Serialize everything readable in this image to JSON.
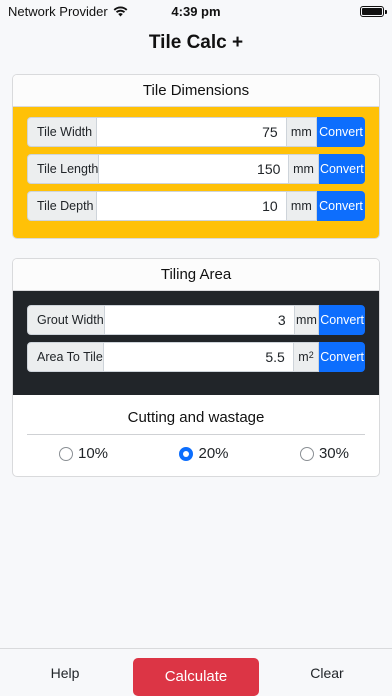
{
  "status_bar": {
    "carrier": "Network Provider",
    "time": "4:39 pm",
    "wifi_icon": "wifi-icon",
    "battery_icon": "battery-icon"
  },
  "app": {
    "title": "Tile Calc +"
  },
  "tile_dimensions": {
    "header": "Tile Dimensions",
    "accent_color": "#ffc107",
    "rows": [
      {
        "label": "Tile Width",
        "value": "75",
        "unit": "mm",
        "button": "Convert"
      },
      {
        "label": "Tile Length",
        "value": "150",
        "unit": "mm",
        "button": "Convert"
      },
      {
        "label": "Tile Depth",
        "value": "10",
        "unit": "mm",
        "button": "Convert"
      }
    ]
  },
  "tiling_area": {
    "header": "Tiling Area",
    "accent_color": "#212529",
    "rows": [
      {
        "label": "Grout Width",
        "value": "3",
        "unit": "mm",
        "button": "Convert"
      },
      {
        "label": "Area To Tile",
        "value": "5.5",
        "unit": "m",
        "unit_sup": "2",
        "button": "Convert"
      }
    ],
    "wastage": {
      "title": "Cutting and wastage",
      "options": [
        {
          "label": "10%",
          "checked": false
        },
        {
          "label": "20%",
          "checked": true
        },
        {
          "label": "30%",
          "checked": false
        }
      ]
    }
  },
  "bottom_bar": {
    "help": "Help",
    "calculate": "Calculate",
    "clear": "Clear",
    "calculate_color": "#dc3545"
  }
}
